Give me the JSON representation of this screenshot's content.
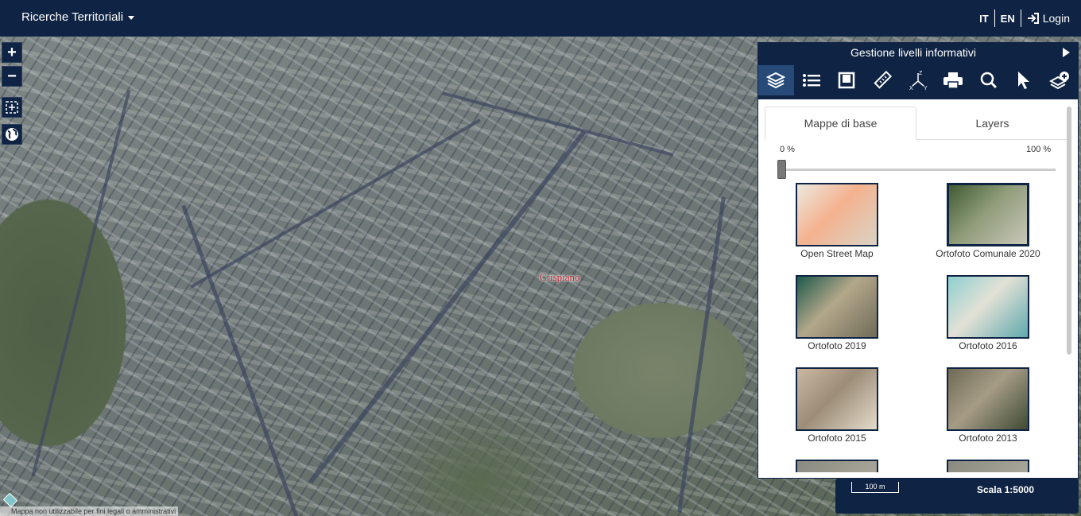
{
  "header": {
    "app_title": "Ricerche Territoriali",
    "lang_it": "IT",
    "lang_en": "EN",
    "login_label": "Login",
    "login_icon": "login-icon"
  },
  "map": {
    "place_label": "Crispiano",
    "controls": [
      {
        "name": "zoom-in-icon",
        "glyph": "+"
      },
      {
        "name": "zoom-out-icon",
        "glyph": "−"
      },
      {
        "name": "zoom-box-icon",
        "glyph": ""
      },
      {
        "name": "globe-icon",
        "glyph": ""
      }
    ],
    "disclaimer": "Mappa non utilizzabile per fini legali o amministrativi"
  },
  "panel": {
    "title": "Gestione livelli informativi",
    "tools": [
      "layers-icon",
      "list-icon",
      "frame-icon",
      "ruler-icon",
      "xyz-coordinates-icon",
      "print-icon",
      "search-icon",
      "pointer-icon",
      "add-layer-icon"
    ],
    "active_tool": "layers-icon",
    "tabs": [
      {
        "label": "Mappe di base",
        "selected": true
      },
      {
        "label": "Layers",
        "selected": false
      }
    ],
    "opacity_min_label": "0 %",
    "opacity_max_label": "100 %",
    "opacity_value": 0,
    "basemaps": [
      {
        "label": "Open Street Map",
        "colors": [
          "#ece9e0",
          "#f4b28f",
          "#d9d3c4"
        ]
      },
      {
        "label": "Ortofoto Comunale 2020",
        "colors": [
          "#3f5a33",
          "#8e9b78",
          "#c9c7b8"
        ],
        "selected": true
      },
      {
        "label": "Ortofoto 2019",
        "colors": [
          "#1e5a4a",
          "#b3a78a",
          "#6f6b58"
        ]
      },
      {
        "label": "Ortofoto 2016",
        "colors": [
          "#8ed0cf",
          "#e3e1d6",
          "#5fa9ad"
        ]
      },
      {
        "label": "Ortofoto 2015",
        "colors": [
          "#c9b9a2",
          "#9d8d78",
          "#e4dccb"
        ]
      },
      {
        "label": "Ortofoto 2013",
        "colors": [
          "#6e6a55",
          "#a69c86",
          "#3f4a34"
        ]
      }
    ]
  },
  "scale": {
    "bar_label": "100 m",
    "scale_text": "Scala 1:5000"
  }
}
